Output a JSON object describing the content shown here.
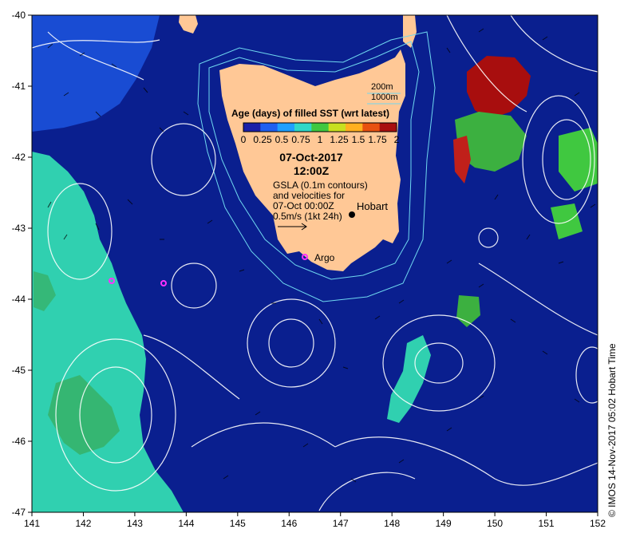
{
  "map": {
    "x_ticks": [
      "141",
      "142",
      "143",
      "144",
      "145",
      "146",
      "147",
      "148",
      "149",
      "150",
      "151",
      "152"
    ],
    "y_ticks": [
      "-40",
      "-41",
      "-42",
      "-43",
      "-44",
      "-45",
      "-46",
      "-47"
    ],
    "lon_range": [
      141,
      152
    ],
    "lat_range": [
      -47,
      -40
    ]
  },
  "legend": {
    "title": "Age (days) of filled SST (wrt latest)",
    "scale_labels": [
      "0",
      "0.25",
      "0.5",
      "0.75",
      "1",
      "1.25",
      "1.5",
      "1.75",
      "2"
    ],
    "colors": [
      "#1a1fa8",
      "#1f5ff0",
      "#1fa0ff",
      "#30d8c8",
      "#40c840",
      "#c8e020",
      "#ffb020",
      "#e85010",
      "#a80e0e"
    ]
  },
  "depth_labels": {
    "shallow": "200m",
    "deep": "1000m"
  },
  "date": {
    "day": "07-Oct-2017",
    "time": "12:00Z"
  },
  "notes": {
    "line1": "GSLA (0.1m contours)",
    "line2": "and velocities for",
    "line3": "07-Oct 00:00Z",
    "scale": "0.5m/s (1kt 24h)"
  },
  "places": {
    "city": "Hobart",
    "argo": "Argo"
  },
  "credit": "© IMOS 14-Nov-2017 05:02 Hobart Time",
  "colors": {
    "ocean": "#0a1f8f",
    "ocean_dark": "#061670",
    "land": "#ffc896",
    "west_patch": "#30d0b0",
    "contour": "#ffffff",
    "isobath": "#6fd8f0"
  }
}
